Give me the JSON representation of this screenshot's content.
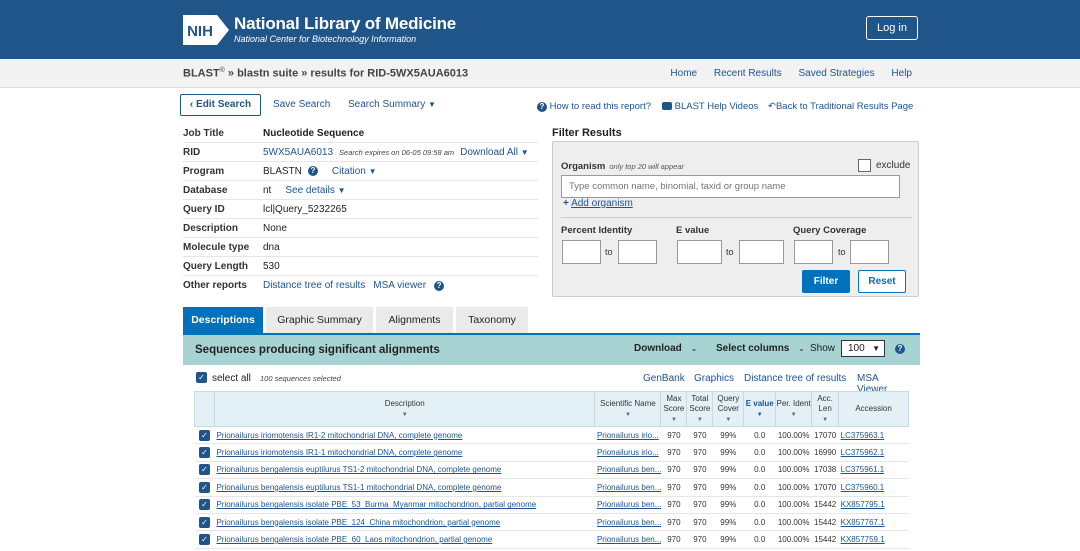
{
  "header": {
    "logo_text": "NIH",
    "title": "National Library of Medicine",
    "subtitle": "National Center for Biotechnology Information",
    "login": "Log in"
  },
  "nav": {
    "crumb_blast": "BLAST",
    "crumb_reg": "®",
    "crumb_rest": " » blastn suite » results for RID-5WX5AUA6013",
    "links": [
      "Home",
      "Recent Results",
      "Saved Strategies",
      "Help"
    ]
  },
  "toolbar": {
    "edit": "‹ Edit Search",
    "save": "Save Search",
    "summary": "Search Summary",
    "how_to": "How to read this report?",
    "videos": "BLAST Help Videos",
    "back": "Back to Traditional Results Page"
  },
  "job": {
    "job_title_label": "Job Title",
    "job_title": "Nucleotide Sequence",
    "rid_label": "RID",
    "rid": "5WX5AUA6013",
    "rid_expires": "Search expires on 06-05 09:58 am",
    "download": "Download All",
    "program_label": "Program",
    "program": "BLASTN",
    "citation": "Citation",
    "database_label": "Database",
    "database": "nt",
    "see_details": "See details",
    "query_id_label": "Query ID",
    "query_id": "lcl|Query_5232265",
    "description_label": "Description",
    "description": "None",
    "molecule_label": "Molecule type",
    "molecule": "dna",
    "query_length_label": "Query Length",
    "query_length": "530",
    "other_label": "Other reports",
    "distance_tree": "Distance tree of results",
    "msa": "MSA viewer"
  },
  "filter": {
    "title": "Filter Results",
    "organism_label": "Organism",
    "organism_note": "only top 20 will appear",
    "exclude": "exclude",
    "organism_placeholder": "Type common name, binomial, taxid or group name",
    "add_organism": "Add organism",
    "percent_identity": "Percent Identity",
    "evalue": "E value",
    "query_coverage": "Query Coverage",
    "to": "to",
    "filter_btn": "Filter",
    "reset_btn": "Reset"
  },
  "tabs": [
    "Descriptions",
    "Graphic Summary",
    "Alignments",
    "Taxonomy"
  ],
  "results": {
    "title": "Sequences producing significant alignments",
    "download": "Download",
    "select_columns": "Select columns",
    "show": "Show",
    "show_value": "100",
    "select_all": "select all",
    "selected_count": "100 sequences selected",
    "links": [
      "GenBank",
      "Graphics",
      "Distance tree of results",
      "MSA Viewer"
    ],
    "columns": [
      "Description",
      "Scientific Name",
      "Max Score",
      "Total Score",
      "Query Cover",
      "E value",
      "Per. Ident",
      "Acc. Len",
      "Accession"
    ],
    "rows": [
      {
        "desc": "Prionailurus iriomotensis IR1-2 mitochondrial DNA, complete genome",
        "sci": "Prionailurus irio...",
        "max": "970",
        "total": "970",
        "cover": "99%",
        "evalue": "0.0",
        "ident": "100.00%",
        "len": "17070",
        "acc": "LC375963.1"
      },
      {
        "desc": "Prionailurus iriomotensis IR1-1 mitochondrial DNA, complete genome",
        "sci": "Prionailurus irio...",
        "max": "970",
        "total": "970",
        "cover": "99%",
        "evalue": "0.0",
        "ident": "100.00%",
        "len": "16990",
        "acc": "LC375962.1"
      },
      {
        "desc": "Prionailurus bengalensis euptilurus TS1-2 mitochondrial DNA, complete genome",
        "sci": "Prionailurus ben...",
        "max": "970",
        "total": "970",
        "cover": "99%",
        "evalue": "0.0",
        "ident": "100.00%",
        "len": "17038",
        "acc": "LC375961.1"
      },
      {
        "desc": "Prionailurus bengalensis euptilurus TS1-1 mitochondrial DNA, complete genome",
        "sci": "Prionailurus ben...",
        "max": "970",
        "total": "970",
        "cover": "99%",
        "evalue": "0.0",
        "ident": "100.00%",
        "len": "17070",
        "acc": "LC375960.1"
      },
      {
        "desc": "Prionailurus bengalensis isolate PBE_53_Burma_Myanmar mitochondrion, partial genome",
        "sci": "Prionailurus ben...",
        "max": "970",
        "total": "970",
        "cover": "99%",
        "evalue": "0.0",
        "ident": "100.00%",
        "len": "15442",
        "acc": "KX857795.1"
      },
      {
        "desc": "Prionailurus bengalensis isolate PBE_124_China mitochondrion, partial genome",
        "sci": "Prionailurus ben...",
        "max": "970",
        "total": "970",
        "cover": "99%",
        "evalue": "0.0",
        "ident": "100.00%",
        "len": "15442",
        "acc": "KX857767.1"
      },
      {
        "desc": "Prionailurus bengalensis isolate PBE_60_Laos mitochondrion, partial genome",
        "sci": "Prionailurus ben...",
        "max": "970",
        "total": "970",
        "cover": "99%",
        "evalue": "0.0",
        "ident": "100.00%",
        "len": "15442",
        "acc": "KX857759.1"
      }
    ]
  }
}
